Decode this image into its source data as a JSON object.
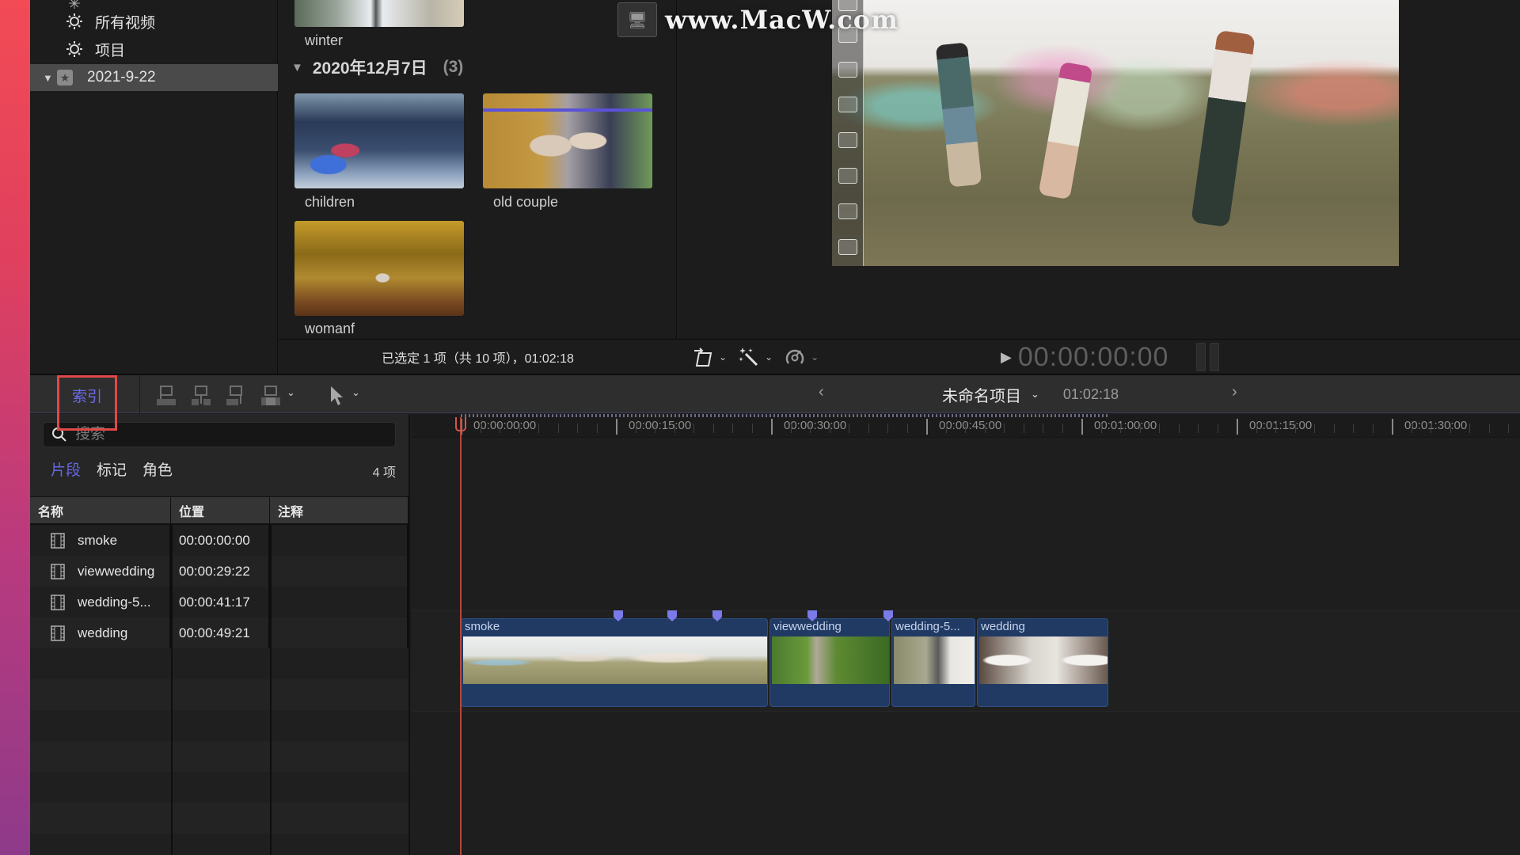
{
  "sidebar": {
    "items": [
      {
        "label": "所有视频",
        "icon": "smart-collection-gear-icon"
      },
      {
        "label": "项目",
        "icon": "smart-collection-gear-icon"
      }
    ],
    "event": {
      "label": "2021-9-22",
      "icon": "event-star-icon",
      "expanded": true,
      "selected": true
    }
  },
  "browser": {
    "clips_top": [
      {
        "label": "winter"
      }
    ],
    "date_group": {
      "label": "2020年12月7日",
      "count": "(3)",
      "expanded": true
    },
    "clips": [
      {
        "label": "children"
      },
      {
        "label": "old couple"
      },
      {
        "label": "womanf"
      }
    ],
    "status": "已选定 1 项（共 10 项），01:02:18"
  },
  "viewer": {
    "watermark": "www.MacW.com",
    "timecode": "00:00:00:00",
    "tools": [
      "transform-icon",
      "enhance-magic-wand-icon",
      "retime-speed-icon"
    ]
  },
  "timeline_toolbar": {
    "index_label": "索引",
    "edit_tools": [
      "connect-clip-icon",
      "insert-clip-icon",
      "append-clip-icon",
      "overwrite-clip-icon"
    ],
    "select_tool": "arrow-pointer-icon",
    "project_name": "未命名项目",
    "project_duration": "01:02:18"
  },
  "index": {
    "search_placeholder": "搜索",
    "tabs": [
      {
        "label": "片段",
        "active": true
      },
      {
        "label": "标记",
        "active": false
      },
      {
        "label": "角色",
        "active": false
      }
    ],
    "count": "4 项",
    "columns": [
      "名称",
      "位置",
      "注释"
    ],
    "rows": [
      {
        "name": "smoke",
        "position": "00:00:00:00",
        "note": ""
      },
      {
        "name": "viewwedding",
        "position": "00:00:29:22",
        "note": ""
      },
      {
        "name": "wedding-5...",
        "position": "00:00:41:17",
        "note": ""
      },
      {
        "name": "wedding",
        "position": "00:00:49:21",
        "note": ""
      }
    ]
  },
  "timeline": {
    "ruler_labels": [
      "00:00:00:00",
      "00:00:15:00",
      "00:00:30:00",
      "00:00:45:00",
      "00:01:00:00",
      "00:01:15:00",
      "00:01:30:00"
    ],
    "clips": [
      {
        "name": "smoke",
        "start": "00:00:00:00"
      },
      {
        "name": "viewwedding",
        "start": "00:00:29:22"
      },
      {
        "name": "wedding-5...",
        "start": "00:00:41:17"
      },
      {
        "name": "wedding",
        "start": "00:00:49:21"
      }
    ],
    "marker_count": 5,
    "colors": {
      "clip": "#213a64",
      "marker": "#7a7ae8",
      "playhead": "#b5473a",
      "active_accent": "#6767e6"
    }
  }
}
